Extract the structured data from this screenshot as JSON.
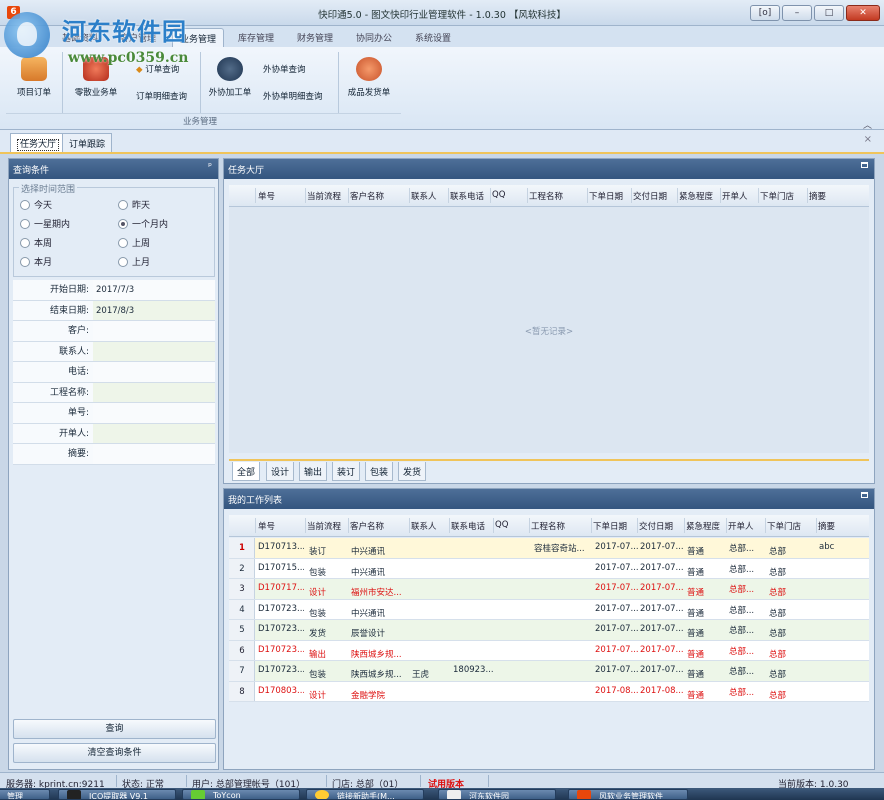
{
  "window": {
    "title": "快印通5.0 - 图文快印行业管理软件 - 1.0.30 【风软科技】",
    "controls": [
      "[o]",
      "–",
      "□",
      "✕"
    ]
  },
  "watermark": {
    "site_name": "河东软件园",
    "url": "www.pc0359.cn"
  },
  "ribbon_tabs": [
    "基础资料",
    "客户管理",
    "业务管理",
    "库存管理",
    "财务管理",
    "协同办公",
    "系统设置"
  ],
  "ribbon": {
    "items": {
      "project_order": "项目订单",
      "retail_order": "零散业务单",
      "order_query": "订单查询",
      "order_detail_query": "订单明细查询",
      "outsource_order": "外协加工单",
      "outsource_query": "外协单查询",
      "outsource_detail_query": "外协单明细查询",
      "finished_shipping": "成品发货单"
    },
    "group_label": "业务管理"
  },
  "doc_tabs": [
    "任务大厅",
    "订单跟踪"
  ],
  "query_panel": {
    "title": "查询条件",
    "range_title": "选择时间范围",
    "radios": [
      {
        "label": "今天",
        "checked": false
      },
      {
        "label": "昨天",
        "checked": false
      },
      {
        "label": "一星期内",
        "checked": false
      },
      {
        "label": "一个月内",
        "checked": true
      },
      {
        "label": "本周",
        "checked": false
      },
      {
        "label": "上周",
        "checked": false
      },
      {
        "label": "本月",
        "checked": false
      },
      {
        "label": "上月",
        "checked": false
      }
    ],
    "fields": [
      {
        "label": "开始日期:",
        "value": "2017/7/3"
      },
      {
        "label": "结束日期:",
        "value": "2017/8/3"
      },
      {
        "label": "客户:",
        "value": ""
      },
      {
        "label": "联系人:",
        "value": ""
      },
      {
        "label": "电话:",
        "value": ""
      },
      {
        "label": "工程名称:",
        "value": ""
      },
      {
        "label": "单号:",
        "value": ""
      },
      {
        "label": "开单人:",
        "value": ""
      },
      {
        "label": "摘要:",
        "value": ""
      }
    ],
    "query_button": "查询",
    "clear_button": "清空查询条件"
  },
  "task_hall": {
    "title": "任务大厅",
    "columns": [
      "单号",
      "当前流程",
      "客户名称",
      "联系人",
      "联系电话",
      "QQ",
      "工程名称",
      "下单日期",
      "交付日期",
      "紧急程度",
      "开单人",
      "下单门店",
      "摘要"
    ],
    "empty_text": "<暂无记录>",
    "filter_tabs": [
      "全部",
      "设计",
      "输出",
      "装订",
      "包装",
      "发货"
    ]
  },
  "work_list": {
    "title": "我的工作列表",
    "columns": [
      "单号",
      "当前流程",
      "客户名称",
      "联系人",
      "联系电话",
      "QQ",
      "工程名称",
      "下单日期",
      "交付日期",
      "紧急程度",
      "开单人",
      "下单门店",
      "摘要"
    ],
    "rows": [
      {
        "n": "1",
        "id": "D170713...",
        "flow": "装订",
        "cust": "中兴通讯",
        "contact": "",
        "phone": "",
        "qq": "",
        "proj": "容桂容奇站...",
        "od": "2017-07...",
        "dd": "2017-07...",
        "urg": "普通",
        "by": "总部...",
        "store": "总部",
        "memo": "abc",
        "style": "sel"
      },
      {
        "n": "2",
        "id": "D170715...",
        "flow": "包装",
        "cust": "中兴通讯",
        "contact": "",
        "phone": "",
        "qq": "",
        "proj": "",
        "od": "2017-07...",
        "dd": "2017-07...",
        "urg": "普通",
        "by": "总部...",
        "store": "总部",
        "memo": "",
        "style": "white"
      },
      {
        "n": "3",
        "id": "D170717...",
        "flow": "设计",
        "cust": "福州市安达...",
        "contact": "",
        "phone": "",
        "qq": "",
        "proj": "",
        "od": "2017-07...",
        "dd": "2017-07...",
        "urg": "普通",
        "by": "总部...",
        "store": "总部",
        "memo": "",
        "style": "green red"
      },
      {
        "n": "4",
        "id": "D170723...",
        "flow": "包装",
        "cust": "中兴通讯",
        "contact": "",
        "phone": "",
        "qq": "",
        "proj": "",
        "od": "2017-07...",
        "dd": "2017-07...",
        "urg": "普通",
        "by": "总部...",
        "store": "总部",
        "memo": "",
        "style": "white"
      },
      {
        "n": "5",
        "id": "D170723...",
        "flow": "发货",
        "cust": "辰誉设计",
        "contact": "",
        "phone": "",
        "qq": "",
        "proj": "",
        "od": "2017-07...",
        "dd": "2017-07...",
        "urg": "普通",
        "by": "总部...",
        "store": "总部",
        "memo": "",
        "style": "green"
      },
      {
        "n": "6",
        "id": "D170723...",
        "flow": "输出",
        "cust": "陕西城乡规...",
        "contact": "",
        "phone": "",
        "qq": "",
        "proj": "",
        "od": "2017-07...",
        "dd": "2017-07...",
        "urg": "普通",
        "by": "总部...",
        "store": "总部",
        "memo": "",
        "style": "white red"
      },
      {
        "n": "7",
        "id": "D170723...",
        "flow": "包装",
        "cust": "陕西城乡规...",
        "contact": "王虎",
        "phone": "180923...",
        "qq": "",
        "proj": "",
        "od": "2017-07...",
        "dd": "2017-07...",
        "urg": "普通",
        "by": "总部...",
        "store": "总部",
        "memo": "",
        "style": "green"
      },
      {
        "n": "8",
        "id": "D170803...",
        "flow": "设计",
        "cust": "金融学院",
        "contact": "",
        "phone": "",
        "qq": "",
        "proj": "",
        "od": "2017-08...",
        "dd": "2017-08...",
        "urg": "普通",
        "by": "总部...",
        "store": "总部",
        "memo": "",
        "style": "white red"
      }
    ]
  },
  "statusbar": {
    "server": "服务器: kprint.cn:9211",
    "state": "状态: 正常",
    "user": "用户: 总部管理帐号（101）",
    "store": "门店: 总部（01）",
    "warn": "试用版本",
    "version": "当前版本: 1.0.30"
  },
  "taskbar": [
    "管理",
    "ICO提取器 V9.1",
    "ToYcon",
    "链接新助手(M...",
    "河东软件园",
    "风软业务管理软件"
  ],
  "colors": {
    "accent": "#33557f",
    "warn": "#dd1111",
    "highlight": "#f0c45a"
  }
}
